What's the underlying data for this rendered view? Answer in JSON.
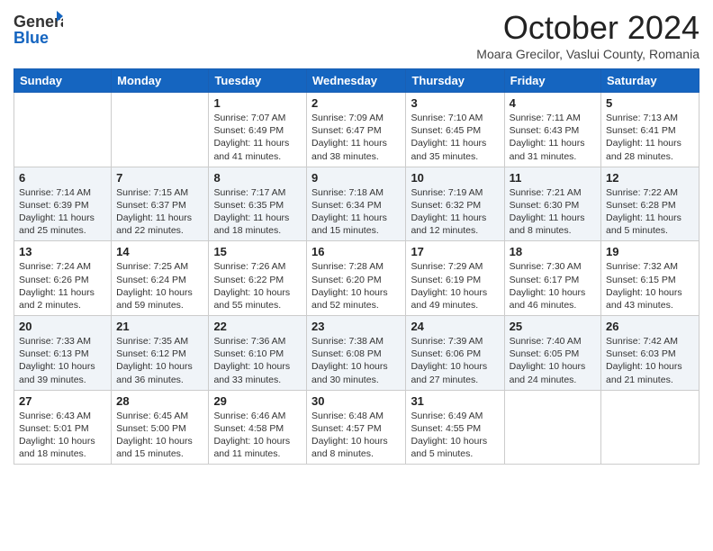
{
  "header": {
    "logo_line1": "General",
    "logo_line2": "Blue",
    "month": "October 2024",
    "location": "Moara Grecilor, Vaslui County, Romania"
  },
  "weekdays": [
    "Sunday",
    "Monday",
    "Tuesday",
    "Wednesday",
    "Thursday",
    "Friday",
    "Saturday"
  ],
  "weeks": [
    [
      {
        "day": "",
        "content": ""
      },
      {
        "day": "",
        "content": ""
      },
      {
        "day": "1",
        "content": "Sunrise: 7:07 AM\nSunset: 6:49 PM\nDaylight: 11 hours and 41 minutes."
      },
      {
        "day": "2",
        "content": "Sunrise: 7:09 AM\nSunset: 6:47 PM\nDaylight: 11 hours and 38 minutes."
      },
      {
        "day": "3",
        "content": "Sunrise: 7:10 AM\nSunset: 6:45 PM\nDaylight: 11 hours and 35 minutes."
      },
      {
        "day": "4",
        "content": "Sunrise: 7:11 AM\nSunset: 6:43 PM\nDaylight: 11 hours and 31 minutes."
      },
      {
        "day": "5",
        "content": "Sunrise: 7:13 AM\nSunset: 6:41 PM\nDaylight: 11 hours and 28 minutes."
      }
    ],
    [
      {
        "day": "6",
        "content": "Sunrise: 7:14 AM\nSunset: 6:39 PM\nDaylight: 11 hours and 25 minutes."
      },
      {
        "day": "7",
        "content": "Sunrise: 7:15 AM\nSunset: 6:37 PM\nDaylight: 11 hours and 22 minutes."
      },
      {
        "day": "8",
        "content": "Sunrise: 7:17 AM\nSunset: 6:35 PM\nDaylight: 11 hours and 18 minutes."
      },
      {
        "day": "9",
        "content": "Sunrise: 7:18 AM\nSunset: 6:34 PM\nDaylight: 11 hours and 15 minutes."
      },
      {
        "day": "10",
        "content": "Sunrise: 7:19 AM\nSunset: 6:32 PM\nDaylight: 11 hours and 12 minutes."
      },
      {
        "day": "11",
        "content": "Sunrise: 7:21 AM\nSunset: 6:30 PM\nDaylight: 11 hours and 8 minutes."
      },
      {
        "day": "12",
        "content": "Sunrise: 7:22 AM\nSunset: 6:28 PM\nDaylight: 11 hours and 5 minutes."
      }
    ],
    [
      {
        "day": "13",
        "content": "Sunrise: 7:24 AM\nSunset: 6:26 PM\nDaylight: 11 hours and 2 minutes."
      },
      {
        "day": "14",
        "content": "Sunrise: 7:25 AM\nSunset: 6:24 PM\nDaylight: 10 hours and 59 minutes."
      },
      {
        "day": "15",
        "content": "Sunrise: 7:26 AM\nSunset: 6:22 PM\nDaylight: 10 hours and 55 minutes."
      },
      {
        "day": "16",
        "content": "Sunrise: 7:28 AM\nSunset: 6:20 PM\nDaylight: 10 hours and 52 minutes."
      },
      {
        "day": "17",
        "content": "Sunrise: 7:29 AM\nSunset: 6:19 PM\nDaylight: 10 hours and 49 minutes."
      },
      {
        "day": "18",
        "content": "Sunrise: 7:30 AM\nSunset: 6:17 PM\nDaylight: 10 hours and 46 minutes."
      },
      {
        "day": "19",
        "content": "Sunrise: 7:32 AM\nSunset: 6:15 PM\nDaylight: 10 hours and 43 minutes."
      }
    ],
    [
      {
        "day": "20",
        "content": "Sunrise: 7:33 AM\nSunset: 6:13 PM\nDaylight: 10 hours and 39 minutes."
      },
      {
        "day": "21",
        "content": "Sunrise: 7:35 AM\nSunset: 6:12 PM\nDaylight: 10 hours and 36 minutes."
      },
      {
        "day": "22",
        "content": "Sunrise: 7:36 AM\nSunset: 6:10 PM\nDaylight: 10 hours and 33 minutes."
      },
      {
        "day": "23",
        "content": "Sunrise: 7:38 AM\nSunset: 6:08 PM\nDaylight: 10 hours and 30 minutes."
      },
      {
        "day": "24",
        "content": "Sunrise: 7:39 AM\nSunset: 6:06 PM\nDaylight: 10 hours and 27 minutes."
      },
      {
        "day": "25",
        "content": "Sunrise: 7:40 AM\nSunset: 6:05 PM\nDaylight: 10 hours and 24 minutes."
      },
      {
        "day": "26",
        "content": "Sunrise: 7:42 AM\nSunset: 6:03 PM\nDaylight: 10 hours and 21 minutes."
      }
    ],
    [
      {
        "day": "27",
        "content": "Sunrise: 6:43 AM\nSunset: 5:01 PM\nDaylight: 10 hours and 18 minutes."
      },
      {
        "day": "28",
        "content": "Sunrise: 6:45 AM\nSunset: 5:00 PM\nDaylight: 10 hours and 15 minutes."
      },
      {
        "day": "29",
        "content": "Sunrise: 6:46 AM\nSunset: 4:58 PM\nDaylight: 10 hours and 11 minutes."
      },
      {
        "day": "30",
        "content": "Sunrise: 6:48 AM\nSunset: 4:57 PM\nDaylight: 10 hours and 8 minutes."
      },
      {
        "day": "31",
        "content": "Sunrise: 6:49 AM\nSunset: 4:55 PM\nDaylight: 10 hours and 5 minutes."
      },
      {
        "day": "",
        "content": ""
      },
      {
        "day": "",
        "content": ""
      }
    ]
  ]
}
